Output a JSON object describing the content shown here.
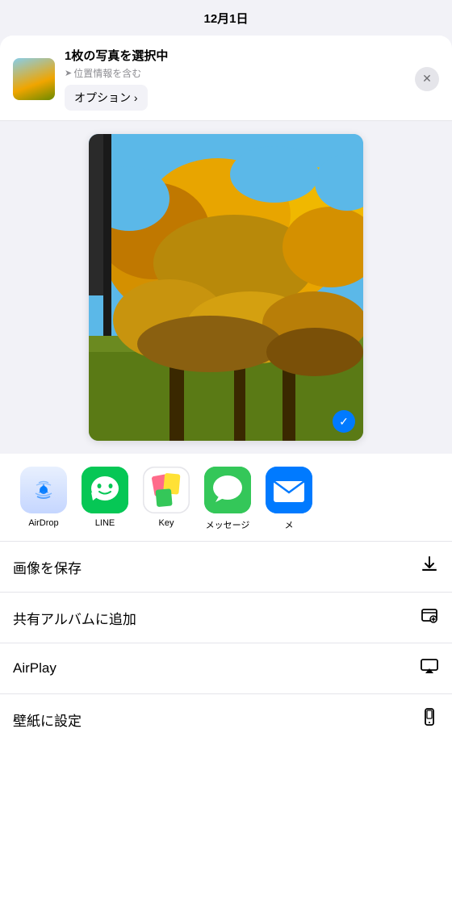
{
  "statusBar": {
    "date": "12月1日"
  },
  "header": {
    "title": "1枚の写真を選択中",
    "locationText": "位置情報を含む",
    "optionsLabel": "オプション ›",
    "closeLabel": "✕"
  },
  "apps": [
    {
      "id": "airdrop",
      "label": "AirDrop",
      "iconType": "airdrop"
    },
    {
      "id": "line",
      "label": "LINE",
      "iconType": "line"
    },
    {
      "id": "key",
      "label": "Key",
      "iconType": "key"
    },
    {
      "id": "messages",
      "label": "メッセージ",
      "iconType": "messages"
    },
    {
      "id": "mail",
      "label": "メ",
      "iconType": "mail"
    }
  ],
  "actions": [
    {
      "id": "save-image",
      "label": "画像を保存",
      "icon": "↓"
    },
    {
      "id": "add-shared-album",
      "label": "共有アルバムに追加",
      "icon": "⊞"
    },
    {
      "id": "airplay",
      "label": "AirPlay",
      "icon": "▲"
    },
    {
      "id": "set-wallpaper",
      "label": "壁紙に設定",
      "icon": "📱"
    }
  ]
}
